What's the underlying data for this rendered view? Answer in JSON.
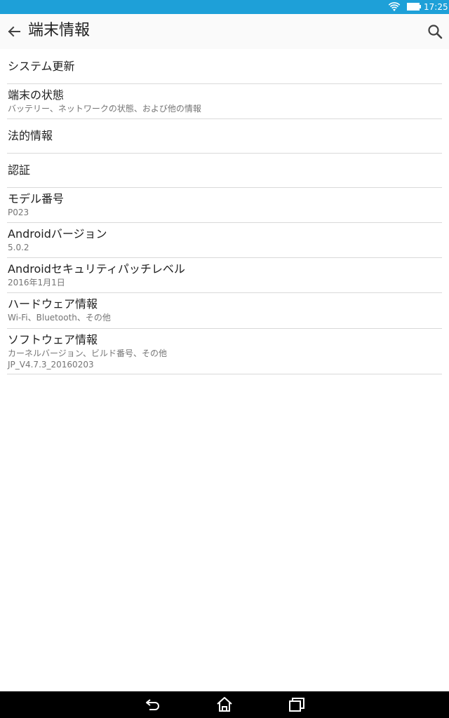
{
  "status_bar": {
    "time": "17:25",
    "wifi_icon": "wifi-icon",
    "battery_icon": "battery-icon",
    "color": "#1ea0d8"
  },
  "app_bar": {
    "title": "端末情報",
    "back_icon": "arrow-back-icon",
    "search_icon": "search-icon"
  },
  "items": [
    {
      "title": "システム更新"
    },
    {
      "title": "端末の状態",
      "summary": "バッテリー、ネットワークの状態、および他の情報"
    },
    {
      "title": "法的情報"
    },
    {
      "title": "認証"
    },
    {
      "title": "モデル番号",
      "summary": "P023"
    },
    {
      "title": "Androidバージョン",
      "summary": "5.0.2"
    },
    {
      "title": "Androidセキュリティパッチレベル",
      "summary": "2016年1月1日"
    },
    {
      "title": "ハードウェア情報",
      "summary": "Wi-Fi、Bluetooth、その他"
    },
    {
      "title": "ソフトウェア情報",
      "summary": "カーネルバージョン、ビルド番号、その他",
      "summary2": "JP_V4.7.3_20160203"
    }
  ],
  "nav_bar": {
    "back_icon": "nav-back-icon",
    "home_icon": "nav-home-icon",
    "recents_icon": "nav-recents-icon"
  }
}
